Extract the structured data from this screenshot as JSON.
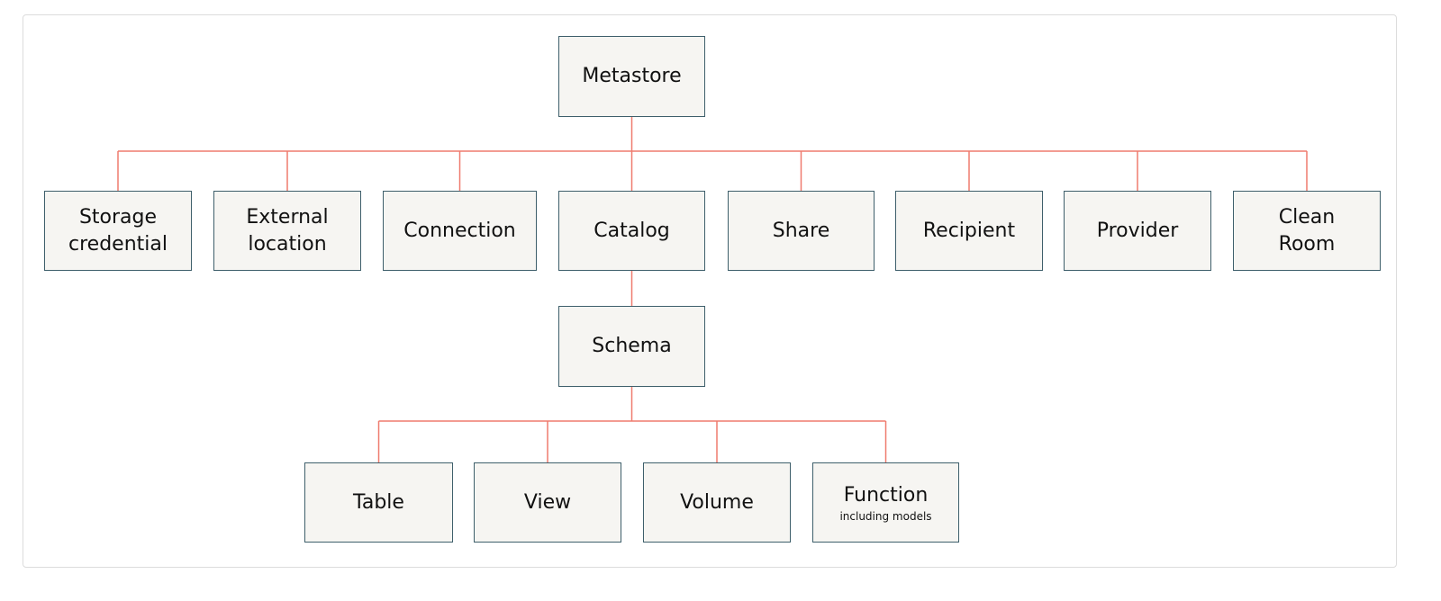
{
  "colors": {
    "connector": "#ef7b6e",
    "box_border": "#3e5f6b",
    "box_fill": "#f6f5f2"
  },
  "nodes": {
    "metastore": {
      "label": "Metastore"
    },
    "storage_credential": {
      "label": "Storage\ncredential"
    },
    "external_location": {
      "label": "External\nlocation"
    },
    "connection": {
      "label": "Connection"
    },
    "catalog": {
      "label": "Catalog"
    },
    "share": {
      "label": "Share"
    },
    "recipient": {
      "label": "Recipient"
    },
    "provider": {
      "label": "Provider"
    },
    "clean_room": {
      "label": "Clean\nRoom"
    },
    "schema": {
      "label": "Schema"
    },
    "table": {
      "label": "Table"
    },
    "view": {
      "label": "View"
    },
    "volume": {
      "label": "Volume"
    },
    "function": {
      "label": "Function",
      "sublabel": "including models"
    }
  },
  "edges": [
    [
      "metastore",
      "storage_credential"
    ],
    [
      "metastore",
      "external_location"
    ],
    [
      "metastore",
      "connection"
    ],
    [
      "metastore",
      "catalog"
    ],
    [
      "metastore",
      "share"
    ],
    [
      "metastore",
      "recipient"
    ],
    [
      "metastore",
      "provider"
    ],
    [
      "metastore",
      "clean_room"
    ],
    [
      "catalog",
      "schema"
    ],
    [
      "schema",
      "table"
    ],
    [
      "schema",
      "view"
    ],
    [
      "schema",
      "volume"
    ],
    [
      "schema",
      "function"
    ]
  ]
}
